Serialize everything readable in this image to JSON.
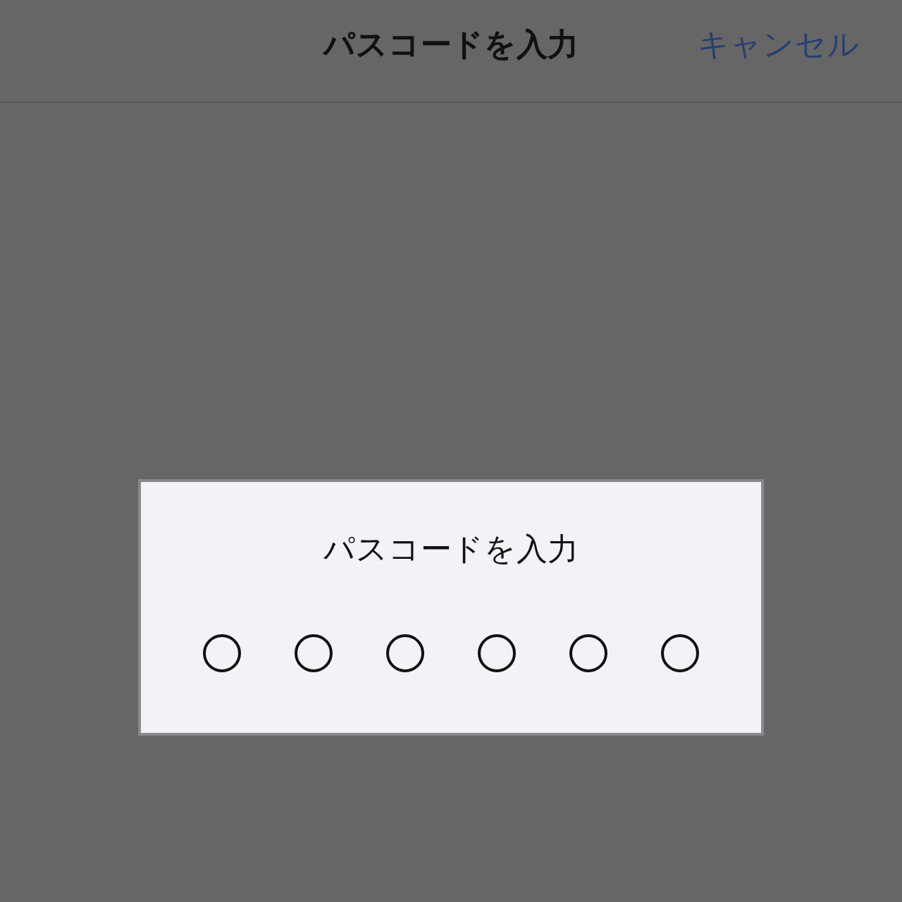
{
  "nav_bar": {
    "title": "パスコードを入力",
    "cancel": "キャンセル"
  },
  "dialog": {
    "prompt": "パスコードを入力",
    "digits": [
      {
        "filled": false
      },
      {
        "filled": false
      },
      {
        "filled": false
      },
      {
        "filled": false
      },
      {
        "filled": false
      },
      {
        "filled": false
      }
    ]
  }
}
